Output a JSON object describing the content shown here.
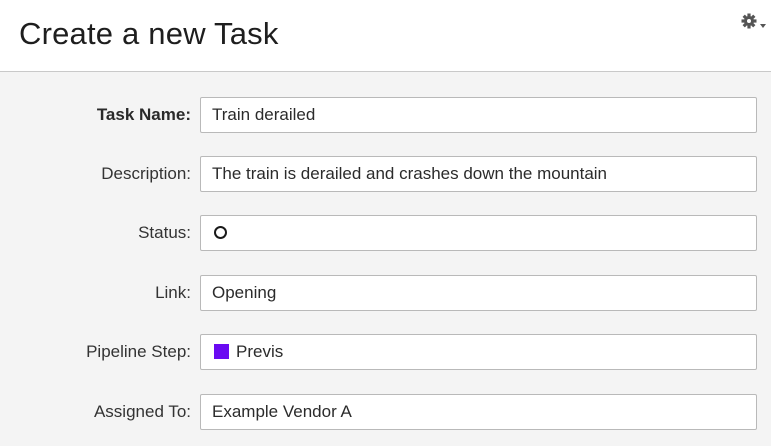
{
  "header": {
    "title": "Create a new Task",
    "settings_icon": "gear-icon"
  },
  "fields": {
    "task_name": {
      "label": "Task Name:",
      "value": "Train derailed"
    },
    "description": {
      "label": "Description:",
      "value": "The train is derailed and crashes down the mountain"
    },
    "status": {
      "label": "Status:",
      "icon": "open-circle-icon"
    },
    "link": {
      "label": "Link:",
      "value": "Opening"
    },
    "pipeline_step": {
      "label": "Pipeline Step:",
      "value": "Previs",
      "color": "#6a0af2"
    },
    "assigned_to": {
      "label": "Assigned To:",
      "value": "Example Vendor A"
    }
  },
  "colors": {
    "header_bg": "#ffffff",
    "body_bg": "#f4f4f4",
    "field_border": "#b9b9b9"
  }
}
